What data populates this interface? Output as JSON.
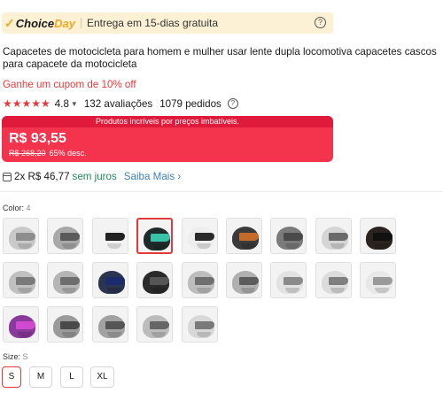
{
  "choice": {
    "brand_choice": "Choice",
    "brand_day": "Day",
    "shipping_text": "Entrega em 15-dias gratuita",
    "help_glyph": "?"
  },
  "product": {
    "title": "Capacetes de motocicleta para homem e mulher usar lente dupla locomotiva capacetes cascos para capacete da motocicleta",
    "coupon": "Ganhe um cupom de 10% off"
  },
  "rating": {
    "stars_glyph": "★★★★★",
    "stars_value": 5,
    "score": "4.8",
    "reviews": "132 avaliações",
    "orders": "1079 pedidos"
  },
  "price": {
    "banner": "Produtos incríveis por preços imbatíveis.",
    "current": "R$ 93,55",
    "original": "R$ 268,20",
    "discount": "65% desc."
  },
  "installment": {
    "text": "2x R$ 46,77",
    "no_interest": "sem juros",
    "more": "Saiba Mais"
  },
  "colors": {
    "label": "Color:",
    "selected_value": "4",
    "accent": "#e4393c",
    "swatches": [
      {
        "shell": "#c9c9c9",
        "visor": "#8e8e8e"
      },
      {
        "shell": "#a8a8a8",
        "visor": "#5a5a5a"
      },
      {
        "shell": "#f2f2f2",
        "visor": "#222222"
      },
      {
        "shell": "#1f2a2a",
        "visor": "#39c2a8"
      },
      {
        "shell": "#eeeeee",
        "visor": "#2a2a2a"
      },
      {
        "shell": "#3a3a3a",
        "visor": "#c46a2a"
      },
      {
        "shell": "#7b7b7b",
        "visor": "#4a4a4a"
      },
      {
        "shell": "#d5d5d5",
        "visor": "#6a6a6a"
      },
      {
        "shell": "#2b2320",
        "visor": "#111111"
      },
      {
        "shell": "#c0c0c0",
        "visor": "#7a7a7a"
      },
      {
        "shell": "#b5b5b5",
        "visor": "#6e6e6e"
      },
      {
        "shell": "#2a3550",
        "visor": "#1a2a6a"
      },
      {
        "shell": "#2a2a2a",
        "visor": "#555555"
      },
      {
        "shell": "#bdbdbd",
        "visor": "#6f6f6f"
      },
      {
        "shell": "#b0b0b0",
        "visor": "#5c5c5c"
      },
      {
        "shell": "#e2e2e2",
        "visor": "#8a8a8a"
      },
      {
        "shell": "#dcdcdc",
        "visor": "#7f7f7f"
      },
      {
        "shell": "#e8e8e8",
        "visor": "#9a9a9a"
      },
      {
        "shell": "#8a3a9a",
        "visor": "#d04ad0"
      },
      {
        "shell": "#9a9a9a",
        "visor": "#4a4a4a"
      },
      {
        "shell": "#a2a2a2",
        "visor": "#555555"
      },
      {
        "shell": "#bcbcbc",
        "visor": "#666666"
      },
      {
        "shell": "#d8d8d8",
        "visor": "#7a7a7a"
      }
    ]
  },
  "sizes": {
    "label": "Size:",
    "selected_value": "S",
    "options": [
      "S",
      "M",
      "L",
      "XL"
    ]
  }
}
